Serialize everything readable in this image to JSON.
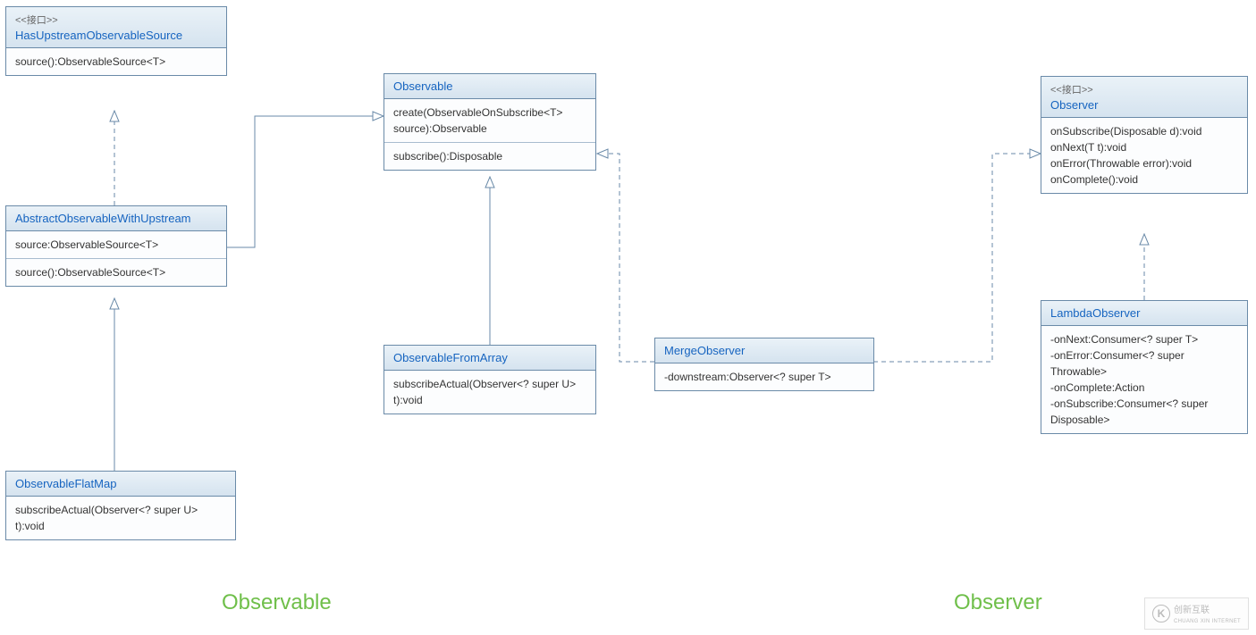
{
  "labels": {
    "observable": "Observable",
    "observer": "Observer"
  },
  "stereotype": "<<接口>>",
  "classes": {
    "hasUpstream": {
      "name": "HasUpstreamObservableSource",
      "methods": [
        "source():ObservableSource<T>"
      ]
    },
    "abstractObs": {
      "name": "AbstractObservableWithUpstream",
      "attrs": [
        "source:ObservableSource<T>"
      ],
      "methods": [
        "source():ObservableSource<T>"
      ]
    },
    "observableFlatMap": {
      "name": "ObservableFlatMap",
      "methods": [
        "subscribeActual(Observer<? super U> t):void"
      ]
    },
    "observable": {
      "name": "Observable",
      "methods": [
        "create(ObservableOnSubscribe<T> source):Observable",
        "subscribe():Disposable"
      ]
    },
    "observableFromArray": {
      "name": "ObservableFromArray",
      "methods": [
        "subscribeActual(Observer<? super U> t):void"
      ]
    },
    "mergeObserver": {
      "name": "MergeObserver",
      "attrs": [
        "-downstream:Observer<? super T>"
      ]
    },
    "observerIf": {
      "name": "Observer",
      "methods": [
        "onSubscribe(Disposable d):void",
        "onNext(T t):void",
        "onError(Throwable error):void",
        "onComplete():void"
      ]
    },
    "lambdaObserver": {
      "name": "LambdaObserver",
      "attrs": [
        "-onNext:Consumer<? super T>",
        "-onError:Consumer<? super Throwable>",
        "-onComplete:Action",
        "-onSubscribe:Consumer<? super Disposable>"
      ]
    }
  },
  "watermark": {
    "text": "创新互联",
    "sub": "CHUANG XIN INTERNET"
  }
}
